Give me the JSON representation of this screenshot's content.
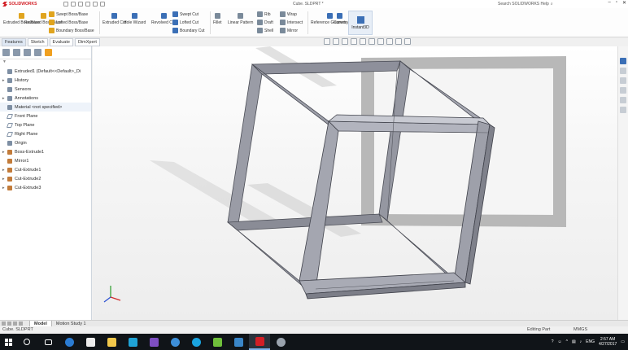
{
  "app": {
    "name": "SOLIDWORKS",
    "title": "Cube. SLDPRT *",
    "search_placeholder": "Search SOLIDWORKS Help"
  },
  "ribbon": {
    "col1": [
      "Extruded Boss/Base",
      "Revolved Boss/Base"
    ],
    "col2": [
      "Swept Boss/Base",
      "Lofted Boss/Base",
      "Boundary Boss/Base"
    ],
    "col3": [
      "Extruded Cut",
      "Hole Wizard"
    ],
    "col4": [
      "Revolved Cut"
    ],
    "col5": [
      "Swept Cut",
      "Lofted Cut",
      "Boundary Cut"
    ],
    "col6": [
      "Fillet",
      "Linear Pattern"
    ],
    "col7": [
      "Rib",
      "Draft",
      "Shell"
    ],
    "col8": [
      "Wrap",
      "Intersect",
      "Mirror"
    ],
    "col9": [
      "Reference Geometry",
      "Curves"
    ],
    "instant3d": "Instant3D"
  },
  "cm_tabs": [
    "Features",
    "Sketch",
    "Evaluate",
    "DimXpert"
  ],
  "feature_tree": [
    {
      "label": "Extruded1 (Default<<Default>_Di",
      "icon": "part",
      "expand": ""
    },
    {
      "label": "History",
      "icon": "folder",
      "expand": "▸"
    },
    {
      "label": "Sensors",
      "icon": "folder",
      "expand": ""
    },
    {
      "label": "Annotations",
      "icon": "folder",
      "expand": "▸"
    },
    {
      "label": "Material <not specified>",
      "icon": "material",
      "expand": ""
    },
    {
      "label": "Front Plane",
      "icon": "plane",
      "expand": ""
    },
    {
      "label": "Top Plane",
      "icon": "plane",
      "expand": ""
    },
    {
      "label": "Right Plane",
      "icon": "plane",
      "expand": ""
    },
    {
      "label": "Origin",
      "icon": "origin",
      "expand": ""
    },
    {
      "label": "Boss-Extrude1",
      "icon": "feat",
      "expand": "▸"
    },
    {
      "label": "Mirror1",
      "icon": "feat",
      "expand": ""
    },
    {
      "label": "Cut-Extrude1",
      "icon": "feat",
      "expand": "▸"
    },
    {
      "label": "Cut-Extrude2",
      "icon": "feat",
      "expand": "▸"
    },
    {
      "label": "Cut-Extrude3",
      "icon": "feat",
      "expand": "▸"
    }
  ],
  "bottom_tabs": [
    "Model",
    "Motion Study 1"
  ],
  "status": {
    "left": "Cube. SLDPRT",
    "mode": "Editing Part",
    "units": "MMGS"
  },
  "taskbar": {
    "time": "2:57 AM",
    "date": "4/27/2017",
    "lang": "ENG"
  }
}
